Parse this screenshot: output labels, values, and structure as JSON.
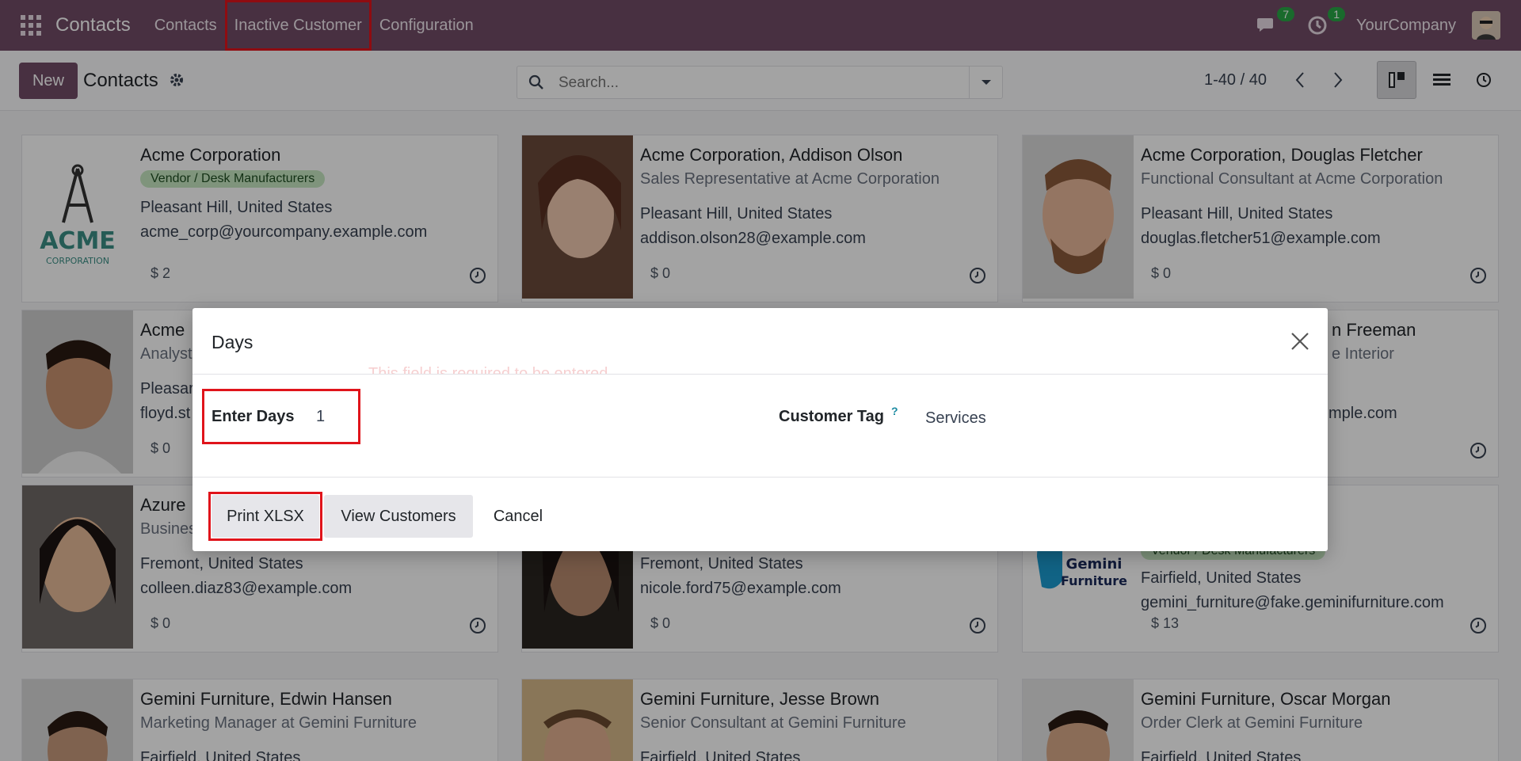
{
  "navbar": {
    "brand": "Contacts",
    "menu": [
      "Contacts",
      "Inactive Customer",
      "Configuration"
    ],
    "messages_count": "7",
    "activities_count": "1",
    "company": "YourCompany"
  },
  "control_panel": {
    "new_label": "New",
    "title": "Contacts",
    "search_placeholder": "Search...",
    "pager": "1-40 / 40"
  },
  "cards": [
    {
      "name": "Acme Corporation",
      "tag": "Vendor / Desk Manufacturers",
      "line1": "Pleasant Hill, United States",
      "line2": "acme_corp@yourcompany.example.com",
      "amount": "$ 2",
      "logo_text": "ACME",
      "logo_sub": "CORPORATION"
    },
    {
      "name": "Acme Corporation, Addison Olson",
      "subtitle": "Sales Representative at Acme Corporation",
      "line1": "Pleasant Hill, United States",
      "line2": "addison.olson28@example.com",
      "amount": "$ 0"
    },
    {
      "name": "Acme Corporation, Douglas Fletcher",
      "subtitle": "Functional Consultant at Acme Corporation",
      "line1": "Pleasant Hill, United States",
      "line2": "douglas.fletcher51@example.com",
      "amount": "$ 0"
    },
    {
      "name": "Acme",
      "subtitle": "Analyst",
      "line1": "Pleasar",
      "line2": "floyd.st",
      "amount": "$ 0"
    },
    {
      "name": "n Freeman",
      "subtitle": "e Interior",
      "line2": "mple.com"
    },
    {
      "name": "Azure",
      "subtitle": "Busines",
      "line1": "Fremont, United States",
      "line2": "colleen.diaz83@example.com",
      "amount": "$ 0"
    },
    {
      "line1": "Fremont, United States",
      "line2": "nicole.ford75@example.com",
      "amount": "$ 0"
    },
    {
      "tag": "Vendor / Desk Manufacturers",
      "line1": "Fairfield, United States",
      "line2": "gemini_furniture@fake.geminifurniture.com",
      "amount": "$ 13",
      "logo_text": "Gemini",
      "logo_sub": "Furniture"
    },
    {
      "name": "Gemini Furniture, Edwin Hansen",
      "subtitle": "Marketing Manager at Gemini Furniture",
      "line1": "Fairfield, United States"
    },
    {
      "name": "Gemini Furniture, Jesse Brown",
      "subtitle": "Senior Consultant at Gemini Furniture",
      "line1": "Fairfield, United States"
    },
    {
      "name": "Gemini Furniture, Oscar Morgan",
      "subtitle": "Order Clerk at Gemini Furniture",
      "line1": "Fairfield, United States"
    }
  ],
  "modal": {
    "title": "Days",
    "faint_warning": "This field is required to be entered",
    "enter_days_label": "Enter Days",
    "enter_days_value": "1",
    "customer_tag_label": "Customer Tag",
    "customer_tag_help": "?",
    "customer_tag_value": "Services",
    "print_xlsx_label": "Print XLSX",
    "view_customers_label": "View Customers",
    "cancel_label": "Cancel"
  },
  "colors": {
    "brand": "#714b67",
    "highlight": "#e0141b",
    "tag_bg": "#c7e8c3",
    "badge": "#28a745"
  },
  "icons": [
    "apps-grid-icon",
    "settings-gear-icon",
    "search-icon",
    "dropdown-caret-icon",
    "chevron-left-icon",
    "chevron-right-icon",
    "kanban-view-icon",
    "list-view-icon",
    "activity-clock-icon",
    "chat-icon",
    "activity-icon",
    "close-icon"
  ]
}
